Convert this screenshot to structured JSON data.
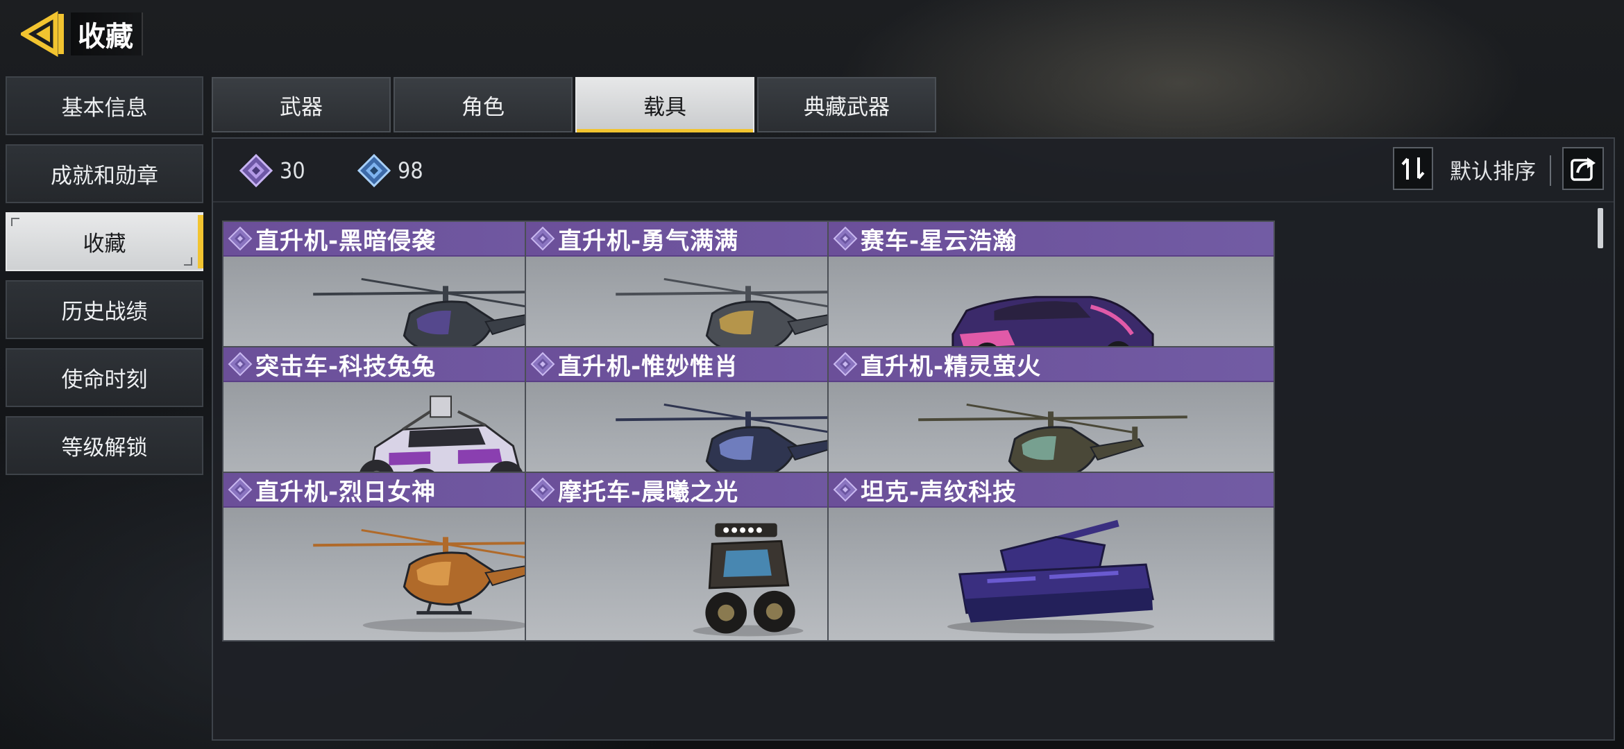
{
  "header": {
    "title": "收藏"
  },
  "side_menu": {
    "items": [
      {
        "label": "基本信息"
      },
      {
        "label": "成就和勋章"
      },
      {
        "label": "收藏"
      },
      {
        "label": "历史战绩"
      },
      {
        "label": "使命时刻"
      },
      {
        "label": "等级解锁"
      }
    ],
    "active_index": 2
  },
  "tabs": {
    "items": [
      {
        "label": "武器"
      },
      {
        "label": "角色"
      },
      {
        "label": "载具"
      },
      {
        "label": "典藏武器"
      }
    ],
    "active_index": 2
  },
  "stats": {
    "purple_count": "30",
    "blue_count": "98"
  },
  "sort": {
    "label": "默认排序"
  },
  "cards": [
    {
      "title": "直升机-黑暗侵袭",
      "kind": "helicopter",
      "color": "#3a3f47",
      "accent": "#5a4a9a"
    },
    {
      "title": "直升机-勇气满满",
      "kind": "helicopter",
      "color": "#4a4e55",
      "accent": "#c8a24a"
    },
    {
      "title": "赛车-星云浩瀚",
      "kind": "car",
      "color": "#3b2a6a",
      "accent": "#e05aa8"
    },
    {
      "title": "突击车-科技兔兔",
      "kind": "buggy",
      "color": "#d8d3e6",
      "accent": "#8a3fb0"
    },
    {
      "title": "直升机-惟妙惟肖",
      "kind": "helicopter",
      "color": "#2f3550",
      "accent": "#7a8ad0"
    },
    {
      "title": "直升机-精灵萤火",
      "kind": "helicopter",
      "color": "#4a4838",
      "accent": "#7fb0a0"
    },
    {
      "title": "直升机-烈日女神",
      "kind": "helicopter",
      "color": "#b06a2a",
      "accent": "#e0a050"
    },
    {
      "title": "摩托车-晨曦之光",
      "kind": "motorcycle",
      "color": "#3a3530",
      "accent": "#4a90c0"
    },
    {
      "title": "坦克-声纹科技",
      "kind": "tank",
      "color": "#3a2f80",
      "accent": "#6a5ad0"
    }
  ],
  "colors": {
    "accent_yellow": "#f2c430",
    "card_header_purple": "#6b4f99",
    "purple_rarity": "#b39ae6",
    "blue_rarity": "#7fb4f0"
  },
  "icons": {
    "back": "back-arrow-icon",
    "sort": "sort-swap-icon",
    "share": "share-icon",
    "rarity": "diamond-rarity-icon"
  }
}
